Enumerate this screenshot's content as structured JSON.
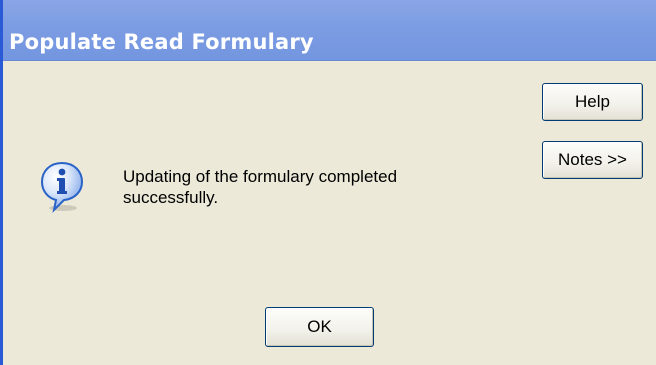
{
  "window": {
    "title": "Populate Read Formulary"
  },
  "message": {
    "text": "Updating of the formulary completed successfully.",
    "icon": "information-icon"
  },
  "buttons": {
    "help_label": "Help",
    "notes_label": "Notes >>",
    "ok_label": "OK"
  },
  "colors": {
    "titlebar": "#7d9de3",
    "dialog_background": "#ece9d8",
    "button_border": "#003c74",
    "icon_blue": "#2a63c8"
  }
}
